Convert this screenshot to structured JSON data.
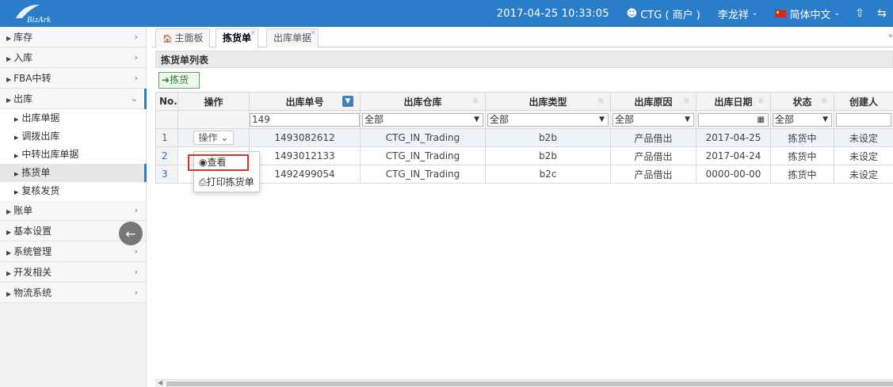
{
  "topbar": {
    "logo_text": "BizArk",
    "datetime": "2017-04-25 10:33:05",
    "company": "CTG ( 商户 )",
    "user": "李龙祥",
    "language": "简体中文",
    "color": "#2a7dc9"
  },
  "sidebar": {
    "items": [
      {
        "label": "库存"
      },
      {
        "label": "入库"
      },
      {
        "label": "FBA中转"
      },
      {
        "label": "出库"
      },
      {
        "label": "账单"
      },
      {
        "label": "基本设置"
      },
      {
        "label": "系统管理"
      },
      {
        "label": "开发相关"
      },
      {
        "label": "物流系统"
      }
    ],
    "sub_items": [
      {
        "label": "出库单据"
      },
      {
        "label": "调拨出库"
      },
      {
        "label": "中转出库单据"
      },
      {
        "label": "拣货单"
      },
      {
        "label": "复核发货"
      }
    ]
  },
  "tabs": [
    {
      "label": "主面板"
    },
    {
      "label": "拣货单"
    },
    {
      "label": "出库单据"
    }
  ],
  "panel": {
    "title": "拣货单列表",
    "pick_button": "拣货"
  },
  "table": {
    "headers": [
      "No.",
      "操作",
      "出库单号",
      "出库仓库",
      "出库类型",
      "出库原因",
      "出库日期",
      "状态",
      "创建人"
    ],
    "filters": {
      "order_no": "149",
      "warehouse": "全部",
      "type": "全部",
      "reason": "全部",
      "date": "",
      "status": "全部"
    },
    "op_label": "操作",
    "rows": [
      {
        "no": "1",
        "order_no": "1493082612",
        "warehouse": "CTG_IN_Trading",
        "type": "b2b",
        "reason": "产品借出",
        "date": "2017-04-25",
        "status": "拣货中",
        "creator": "未设定"
      },
      {
        "no": "2",
        "order_no": "1493012133",
        "warehouse": "CTG_IN_Trading",
        "type": "b2b",
        "reason": "产品借出",
        "date": "2017-04-24",
        "status": "拣货中",
        "creator": "未设定"
      },
      {
        "no": "3",
        "order_no": "1492499054",
        "warehouse": "CTG_IN_Trading",
        "type": "b2c",
        "reason": "产品借出",
        "date": "0000-00-00",
        "status": "拣货中",
        "creator": "未设定"
      }
    ]
  },
  "dropdown": {
    "view": "查看",
    "print": "打印拣货单"
  }
}
